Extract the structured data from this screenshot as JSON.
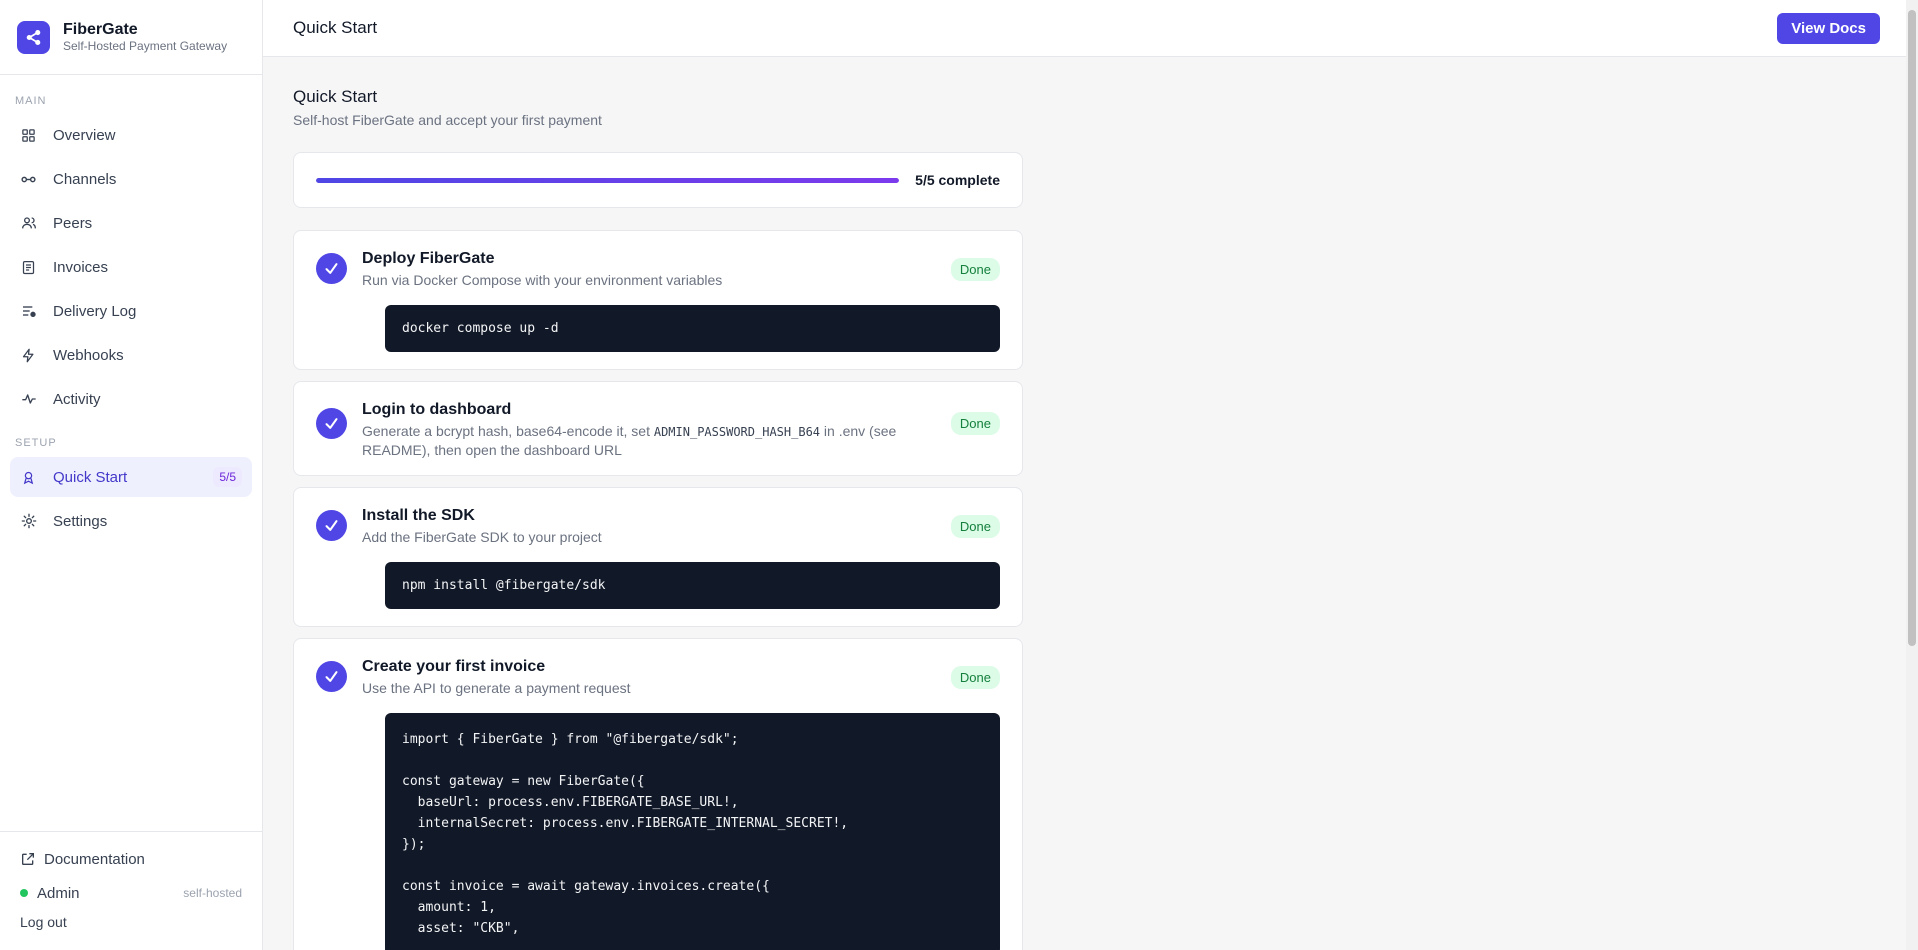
{
  "brand": {
    "name": "FiberGate",
    "subtitle": "Self-Hosted Payment Gateway"
  },
  "sidebar": {
    "main_label": "MAIN",
    "setup_label": "SETUP",
    "main_items": [
      {
        "label": "Overview",
        "icon": "grid-icon"
      },
      {
        "label": "Channels",
        "icon": "link-icon"
      },
      {
        "label": "Peers",
        "icon": "users-icon"
      },
      {
        "label": "Invoices",
        "icon": "document-icon"
      },
      {
        "label": "Delivery Log",
        "icon": "list-icon"
      },
      {
        "label": "Webhooks",
        "icon": "bolt-icon"
      },
      {
        "label": "Activity",
        "icon": "activity-icon"
      }
    ],
    "setup_items": [
      {
        "label": "Quick Start",
        "icon": "rocket-icon",
        "badge": "5/5",
        "active": true
      },
      {
        "label": "Settings",
        "icon": "gear-icon"
      }
    ],
    "footer": {
      "docs_label": "Documentation",
      "user": "Admin",
      "user_tag": "self-hosted",
      "logout": "Log out",
      "status_color": "#22c55e"
    }
  },
  "topbar": {
    "title": "Quick Start",
    "docs_button": "View Docs"
  },
  "page": {
    "title": "Quick Start",
    "subtitle": "Self-host FiberGate and accept your first payment",
    "progress": {
      "text": "5/5 complete",
      "completed": 5,
      "total": 5
    }
  },
  "steps": [
    {
      "title": "Deploy FiberGate",
      "desc": "Run via Docker Compose with your environment variables",
      "status": "Done",
      "code": "docker compose up -d"
    },
    {
      "title": "Login to dashboard",
      "desc_before": "Generate a bcrypt hash, base64-encode it, set ",
      "desc_code": "ADMIN_PASSWORD_HASH_B64",
      "desc_after": " in .env (see README), then open the dashboard URL",
      "status": "Done"
    },
    {
      "title": "Install the SDK",
      "desc": "Add the FiberGate SDK to your project",
      "status": "Done",
      "code": "npm install @fibergate/sdk"
    },
    {
      "title": "Create your first invoice",
      "desc": "Use the API to generate a payment request",
      "status": "Done",
      "code": "import { FiberGate } from \"@fibergate/sdk\";\n\nconst gateway = new FiberGate({\n  baseUrl: process.env.FIBERGATE_BASE_URL!,\n  internalSecret: process.env.FIBERGATE_INTERNAL_SECRET!,\n});\n\nconst invoice = await gateway.invoices.create({\n  amount: 1,\n  asset: \"CKB\","
    }
  ],
  "colors": {
    "accent": "#4f46e5",
    "done_bg": "#dcfce7",
    "done_text": "#15803d",
    "code_bg": "#111827"
  }
}
